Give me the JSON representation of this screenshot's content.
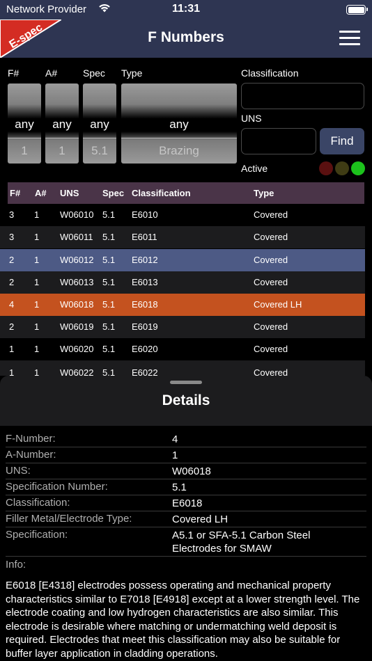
{
  "status_bar": {
    "carrier": "Network Provider",
    "time": "11:31"
  },
  "nav": {
    "title": "F Numbers",
    "logo_text": "E-spec"
  },
  "filters": {
    "f_label": "F#",
    "a_label": "A#",
    "spec_label": "Spec",
    "type_label": "Type",
    "f_value": "any",
    "f_next": "1",
    "a_value": "any",
    "a_next": "1",
    "spec_value": "any",
    "spec_next": "5.1",
    "type_value": "any",
    "type_next": "Brazing",
    "classification_label": "Classification",
    "classification_value": "",
    "uns_label": "UNS",
    "uns_value": "",
    "find_label": "Find",
    "active_label": "Active"
  },
  "colors": {
    "nav": "#2e3552",
    "header": "#4a3448",
    "selected": "#4d5a85",
    "highlight": "#c4521f",
    "dot_red": "#5a1010",
    "dot_olive": "#3f3c14",
    "dot_green": "#1cc21c"
  },
  "table": {
    "headers": [
      "F#",
      "A#",
      "UNS",
      "Spec",
      "Classification",
      "Type"
    ],
    "rows": [
      [
        "3",
        "1",
        "W06010",
        "5.1",
        "E6010",
        "Covered"
      ],
      [
        "3",
        "1",
        "W06011",
        "5.1",
        "E6011",
        "Covered"
      ],
      [
        "2",
        "1",
        "W06012",
        "5.1",
        "E6012",
        "Covered"
      ],
      [
        "2",
        "1",
        "W06013",
        "5.1",
        "E6013",
        "Covered"
      ],
      [
        "4",
        "1",
        "W06018",
        "5.1",
        "E6018",
        "Covered LH"
      ],
      [
        "2",
        "1",
        "W06019",
        "5.1",
        "E6019",
        "Covered"
      ],
      [
        "1",
        "1",
        "W06020",
        "5.1",
        "E6020",
        "Covered"
      ],
      [
        "1",
        "1",
        "W06022",
        "5.1",
        "E6022",
        "Covered"
      ]
    ]
  },
  "details": {
    "title": "Details",
    "rows": [
      [
        "F-Number:",
        "4"
      ],
      [
        "A-Number:",
        "1"
      ],
      [
        "UNS:",
        "W06018"
      ],
      [
        "Specification Number:",
        "5.1"
      ],
      [
        "Classification:",
        "E6018"
      ],
      [
        "Filler Metal/Electrode Type:",
        "Covered LH"
      ],
      [
        "Specification:",
        "A5.1 or SFA-5.1 Carbon Steel Electrodes for SMAW"
      ]
    ],
    "info_label": "Info:",
    "info_text": "E6018 [E4318] electrodes possess operating and mechanical property characteristics similar to E7018 [E4918] except at a lower strength level. The electrode coating and low hydrogen characteristics are also similar. This electrode is desirable where matching or undermatching weld deposit is required. Electrodes that meet this classification may also be suitable for buffer layer application in cladding operations."
  }
}
